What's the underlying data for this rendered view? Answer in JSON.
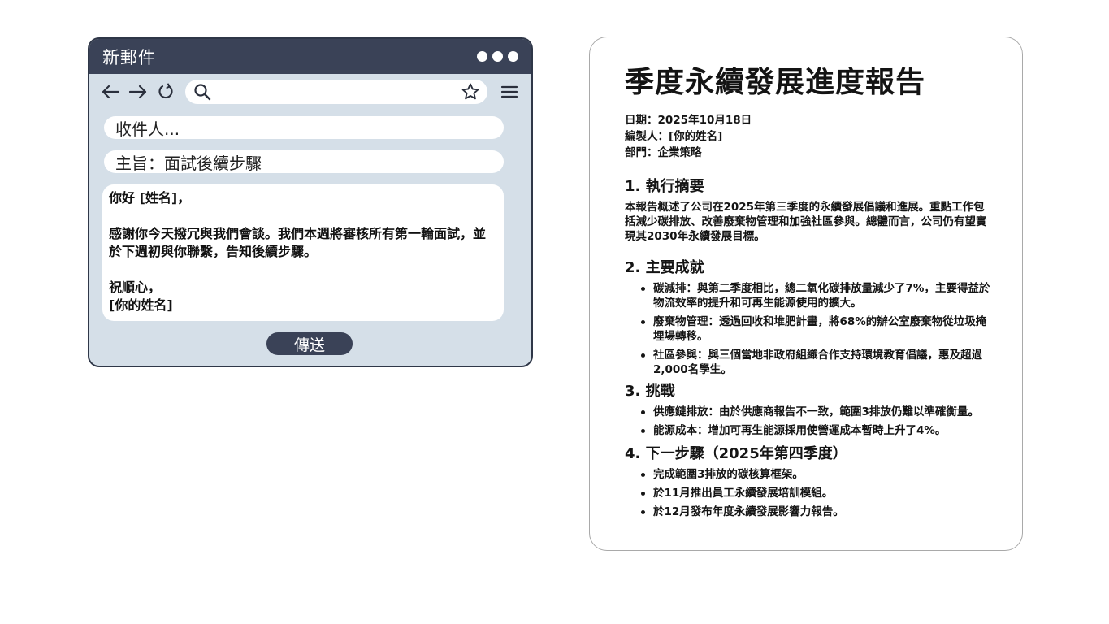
{
  "email": {
    "title": "新郵件",
    "to_placeholder": "收件人...",
    "subject": "主旨：面試後續步驟",
    "body": {
      "greeting": "你好 [姓名]，",
      "paragraph": "感謝你今天撥冗與我們會談。我們本週將審核所有第一輪面試，並於下週初與你聯繫，告知後續步驟。",
      "closing": "祝順心，",
      "signature": "[你的姓名]"
    },
    "send_label": "傳送",
    "icons": [
      "back-arrow-icon",
      "forward-arrow-icon",
      "reload-icon",
      "search-icon",
      "star-icon",
      "menu-icon",
      "more-dots-icon"
    ]
  },
  "report": {
    "title": "季度永續發展進度報告",
    "meta": {
      "date": "日期：2025年10月18日",
      "author": "編製人：[你的姓名]",
      "department": "部門：企業策略"
    },
    "sections": {
      "summary": {
        "title": "1. 執行摘要",
        "text": "本報告概述了公司在2025年第三季度的永續發展倡議和進展。重點工作包括減少碳排放、改善廢棄物管理和加強社區參與。總體而言，公司仍有望實現其2030年永續發展目標。"
      },
      "achievements": {
        "title": "2. 主要成就",
        "items": [
          "碳減排：與第二季度相比，總二氧化碳排放量減少了7%，主要得益於物流效率的提升和可再生能源使用的擴大。",
          "廢棄物管理：透過回收和堆肥計畫，將68%的辦公室廢棄物從垃圾掩埋場轉移。",
          "社區參與：與三個當地非政府組織合作支持環境教育倡議，惠及超過2,000名學生。"
        ]
      },
      "challenges": {
        "title": "3. 挑戰",
        "items": [
          "供應鏈排放：由於供應商報告不一致，範圍3排放仍難以準確衡量。",
          "能源成本：增加可再生能源採用使營運成本暫時上升了4%。"
        ]
      },
      "next_steps": {
        "title": "4. 下一步驟（2025年第四季度）",
        "items": [
          "完成範圍3排放的碳核算框架。",
          "於11月推出員工永續發展培訓模組。",
          "於12月發布年度永續發展影響力報告。"
        ]
      }
    }
  },
  "colors": {
    "titlebar": "#3a4257",
    "window_bg": "#d5dfe8",
    "field_bg": "#ffffff",
    "text": "#1b1b1b"
  }
}
